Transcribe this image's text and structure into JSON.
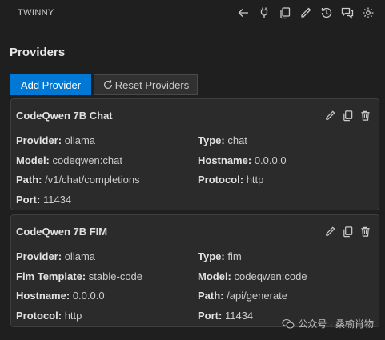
{
  "app": {
    "title": "TWINNY"
  },
  "toolbar": {
    "icons": [
      "arrow-left-icon",
      "plug-icon",
      "copy-icon",
      "pencil-icon",
      "history-icon",
      "comment-discussion-icon",
      "gear-icon"
    ]
  },
  "section": {
    "title": "Providers"
  },
  "buttons": {
    "add_provider": "Add Provider",
    "reset_providers": "Reset Providers"
  },
  "providers": [
    {
      "name": "CodeQwen 7B Chat",
      "fields": [
        {
          "label": "Provider:",
          "value": "ollama"
        },
        {
          "label": "Type:",
          "value": "chat"
        },
        {
          "label": "Model:",
          "value": "codeqwen:chat"
        },
        {
          "label": "Hostname:",
          "value": "0.0.0.0"
        },
        {
          "label": "Path:",
          "value": "/v1/chat/completions"
        },
        {
          "label": "Protocol:",
          "value": "http"
        },
        {
          "label": "Port:",
          "value": "11434"
        }
      ]
    },
    {
      "name": "CodeQwen 7B FIM",
      "fields": [
        {
          "label": "Provider:",
          "value": "ollama"
        },
        {
          "label": "Type:",
          "value": "fim"
        },
        {
          "label": "Fim Template:",
          "value": "stable-code"
        },
        {
          "label": "Model:",
          "value": "codeqwen:code"
        },
        {
          "label": "Hostname:",
          "value": "0.0.0.0"
        },
        {
          "label": "Path:",
          "value": "/api/generate"
        },
        {
          "label": "Protocol:",
          "value": "http"
        },
        {
          "label": "Port:",
          "value": "11434"
        }
      ]
    }
  ],
  "watermark": {
    "text": "公众号 · 桑榆肖物"
  },
  "colors": {
    "background": "#1f1f1f",
    "card": "#2b2b2b",
    "primary_button": "#0078d4"
  }
}
